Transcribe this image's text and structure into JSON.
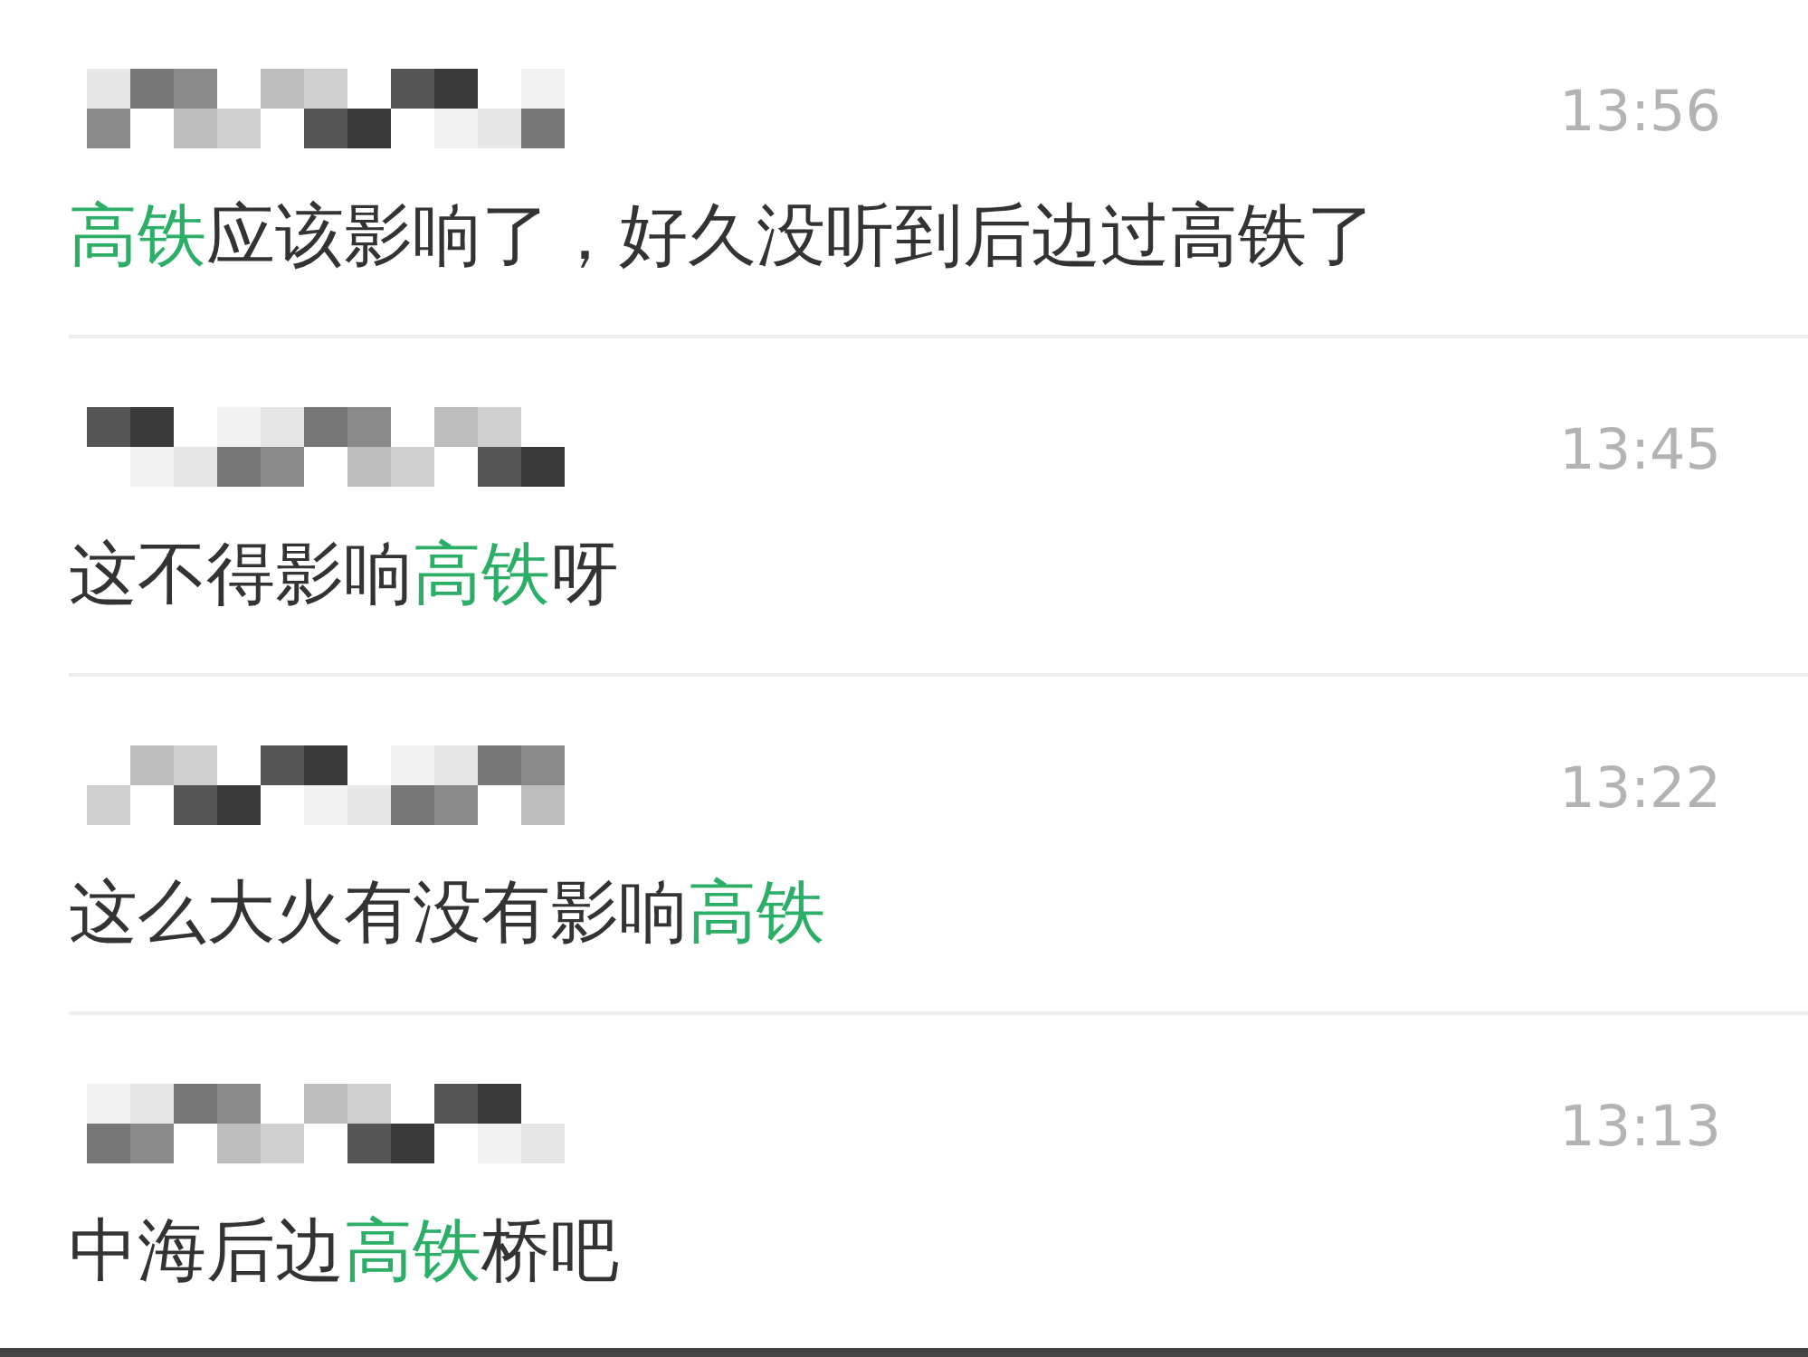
{
  "results": [
    {
      "time": "13:56",
      "message": [
        {
          "text": "高铁",
          "highlight": true
        },
        {
          "text": "应该影响了，好久没听到后边过高铁了",
          "highlight": false
        }
      ]
    },
    {
      "time": "13:45",
      "message": [
        {
          "text": "这不得影响",
          "highlight": false
        },
        {
          "text": "高铁",
          "highlight": true
        },
        {
          "text": "呀",
          "highlight": false
        }
      ]
    },
    {
      "time": "13:22",
      "message": [
        {
          "text": "这么大火有没有影响",
          "highlight": false
        },
        {
          "text": "高铁",
          "highlight": true
        }
      ]
    },
    {
      "time": "13:13",
      "message": [
        {
          "text": "中海后边",
          "highlight": false
        },
        {
          "text": "高铁",
          "highlight": true
        },
        {
          "text": "桥吧",
          "highlight": false
        }
      ]
    }
  ]
}
